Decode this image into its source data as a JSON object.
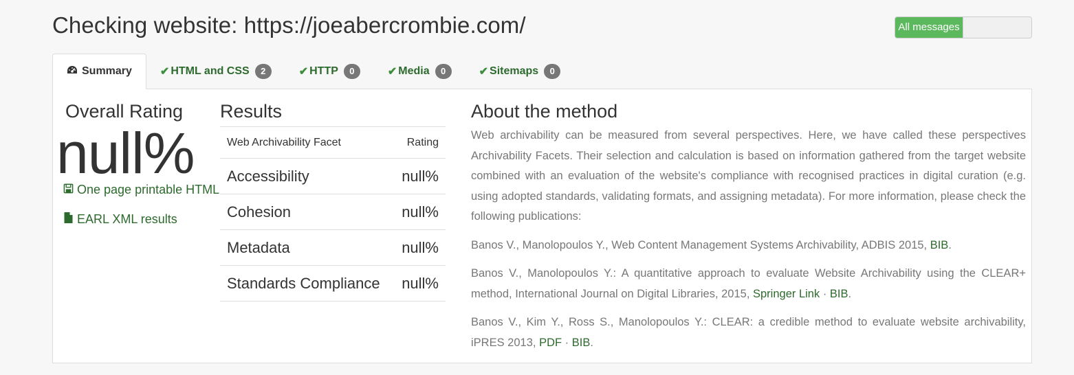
{
  "page": {
    "title": "Checking website: https://joeabercrombie.com/"
  },
  "toggle": {
    "label": "All messages"
  },
  "tabs": [
    {
      "label": "Summary",
      "icon": "gauge-icon"
    },
    {
      "label": "HTML and CSS",
      "icon": "check-icon",
      "count": "2"
    },
    {
      "label": "HTTP",
      "icon": "check-icon",
      "count": "0"
    },
    {
      "label": "Media",
      "icon": "check-icon",
      "count": "0"
    },
    {
      "label": "Sitemaps",
      "icon": "check-icon",
      "count": "0"
    }
  ],
  "overall": {
    "title": "Overall Rating",
    "value": "null%",
    "links": [
      {
        "label": "One page printable HTML",
        "icon": "floppy-disk-icon"
      },
      {
        "label": "EARL XML results",
        "icon": "file-icon"
      }
    ]
  },
  "results": {
    "title": "Results",
    "header": {
      "facet": "Web Archivability Facet",
      "rating": "Rating"
    },
    "rows": [
      {
        "facet": "Accessibility",
        "rating": "null%"
      },
      {
        "facet": "Cohesion",
        "rating": "null%"
      },
      {
        "facet": "Metadata",
        "rating": "null%"
      },
      {
        "facet": "Standards Compliance",
        "rating": "null%"
      }
    ]
  },
  "about": {
    "title": "About the method",
    "intro": "Web archivability can be measured from several perspectives. Here, we have called these perspectives Archivability Facets. Their selection and calculation is based on information gathered from the target website combined with an evaluation of the website's compliance with recognised practices in digital curation (e.g. using adopted standards, validating formats, and assigning metadata). For more information, please check the following publications:",
    "publications": [
      {
        "text": "Banos V., Manolopoulos Y., Web Content Management Systems Archivability, ADBIS 2015, ",
        "links": [
          "BIB"
        ]
      },
      {
        "text": "Banos V., Manolopoulos Y.: A quantitative approach to evaluate Website Archivability using the CLEAR+ method, International Journal on Digital Libraries, 2015, ",
        "links": [
          "Springer Link",
          "BIB"
        ]
      },
      {
        "text": "Banos V., Kim Y., Ross S., Manolopoulos Y.: CLEAR: a credible method to evaluate website archivability, iPRES 2013, ",
        "links": [
          "PDF",
          "BIB"
        ]
      }
    ],
    "separator": " · ",
    "end": "."
  },
  "colors": {
    "accent": "#2d6a2d",
    "toggle_on": "#5cb85c",
    "badge": "#777777"
  }
}
